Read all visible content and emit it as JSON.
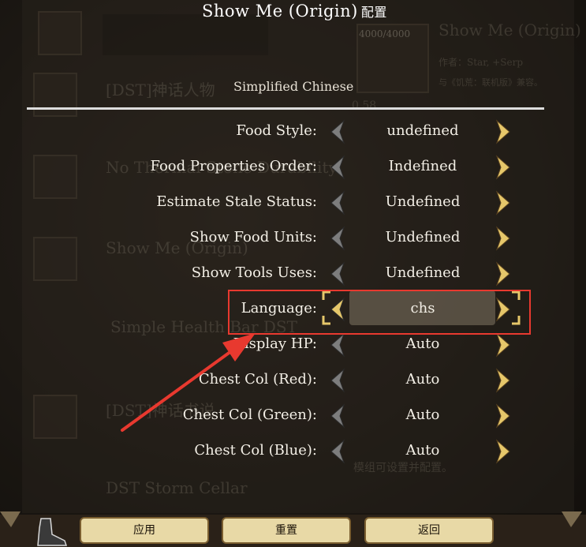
{
  "title": {
    "name": "Show Me (Origin)",
    "suffix": "配置"
  },
  "language_header": "Simplified Chinese",
  "background": {
    "mods": [
      "[DST]神话人物",
      "No Thermal Stone Durability",
      "Show Me (Origin)",
      "Simple Health Bar DST",
      "[DST]神话书说",
      "DST Storm Cellar"
    ],
    "preview": {
      "count": "4000/4000",
      "name": "Show Me (Origin)",
      "author": "作者：Star, +Serp",
      "compat": "与《饥荒：联机版》兼容。",
      "version": "0.58"
    },
    "hint": "模组可设置并配置。"
  },
  "options": [
    {
      "label": "Food Style:",
      "value": "undefined"
    },
    {
      "label": "Food Properties Order:",
      "value": "Indefined"
    },
    {
      "label": "Estimate Stale Status:",
      "value": "Undefined"
    },
    {
      "label": "Show Food Units:",
      "value": "Undefined"
    },
    {
      "label": "Show Tools Uses:",
      "value": "Undefined"
    },
    {
      "label": "Language:",
      "value": "chs"
    },
    {
      "label": "Display HP:",
      "value": "Auto"
    },
    {
      "label": "Chest Col (Red):",
      "value": "Auto"
    },
    {
      "label": "Chest Col (Green):",
      "value": "Auto"
    },
    {
      "label": "Chest Col (Blue):",
      "value": "Auto"
    }
  ],
  "buttons": {
    "apply": "应用",
    "reset": "重置",
    "back": "返回"
  },
  "colors": {
    "highlight": "#e8392f",
    "arrow_gold": "#e6c76a",
    "arrow_grey": "#8a8a8a",
    "button_bg": "#e8d9a6"
  }
}
